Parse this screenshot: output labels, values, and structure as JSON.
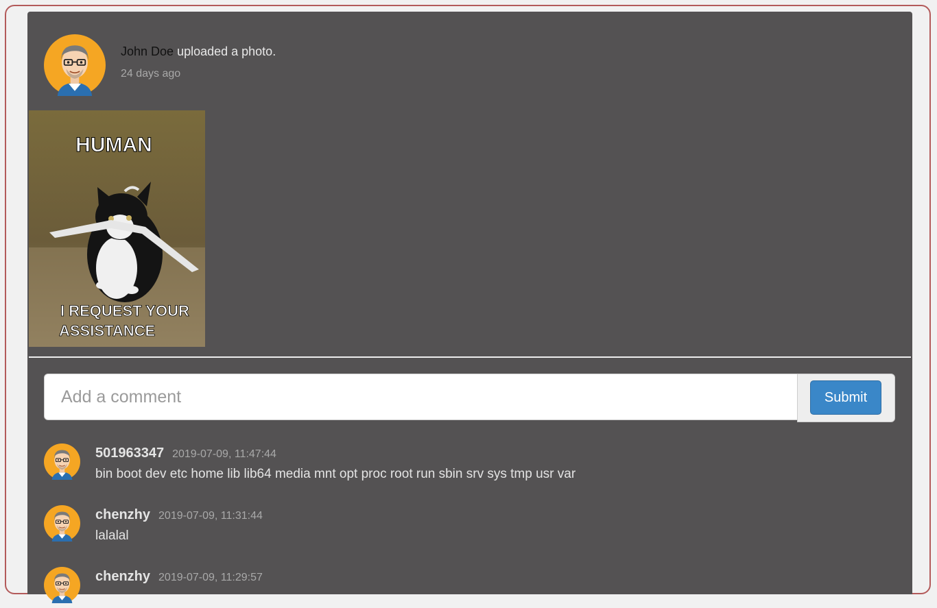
{
  "post": {
    "author": "John Doe",
    "action": " uploaded a photo.",
    "time": "24 days ago",
    "photo": {
      "caption_top": "HUMAN",
      "caption_bottom_line1": "I REQUEST YOUR",
      "caption_bottom_line2": "ASSISTANCE"
    }
  },
  "comment_form": {
    "placeholder": "Add a comment",
    "submit_label": "Submit"
  },
  "comments": [
    {
      "user": "501963347",
      "time": "2019-07-09, 11:47:44",
      "text": "bin boot dev etc home lib lib64 media mnt opt proc root run sbin srv sys tmp usr var"
    },
    {
      "user": "chenzhy",
      "time": "2019-07-09, 11:31:44",
      "text": "lalalal"
    },
    {
      "user": "chenzhy",
      "time": "2019-07-09, 11:29:57",
      "text": ""
    }
  ],
  "colors": {
    "card_bg": "#545253",
    "submit_bg": "#3a87c8",
    "avatar_bg": "#f5a623"
  }
}
